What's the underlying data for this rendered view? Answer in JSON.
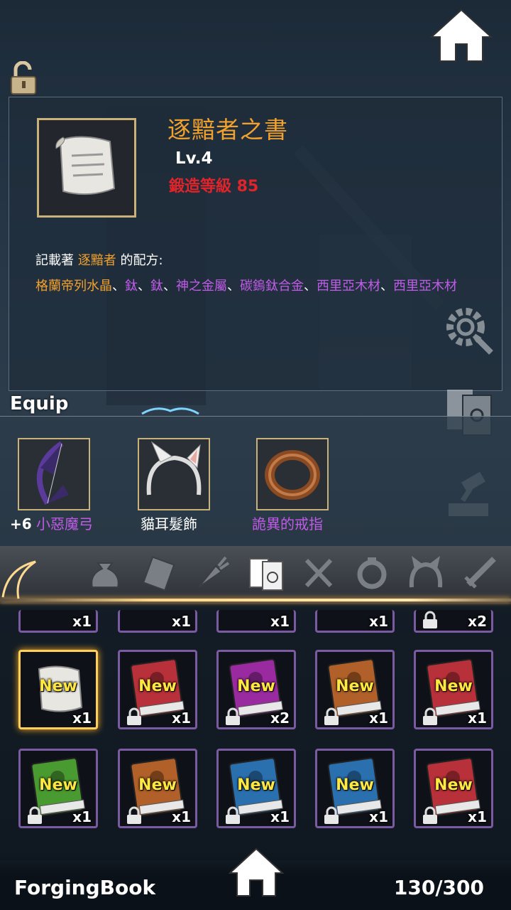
{
  "item": {
    "name": "逐黯者之書",
    "level": "Lv.4",
    "forge_level": "鍛造等級 85",
    "desc_prefix": "記載著",
    "desc_target": "逐黯者",
    "desc_suffix": "的配方:",
    "recipe": [
      {
        "text": "格蘭帝列水晶",
        "color": "orange"
      },
      {
        "text": "、",
        "color": "white"
      },
      {
        "text": "鈦",
        "color": "purple"
      },
      {
        "text": "、",
        "color": "white"
      },
      {
        "text": "鈦",
        "color": "purple"
      },
      {
        "text": "、",
        "color": "white"
      },
      {
        "text": "神之金屬",
        "color": "purple"
      },
      {
        "text": "、",
        "color": "white"
      },
      {
        "text": "碳鎢鈦合金",
        "color": "purple"
      },
      {
        "text": "、",
        "color": "white"
      },
      {
        "text": "西里亞木材",
        "color": "purple"
      },
      {
        "text": "、",
        "color": "white"
      },
      {
        "text": "西里亞木材",
        "color": "purple"
      }
    ]
  },
  "equip": {
    "label": "Equip",
    "slots": [
      {
        "prefix": "+6",
        "name": "小惡魔弓",
        "color": "#c05be8",
        "icon": "bow-icon"
      },
      {
        "prefix": "",
        "name": "貓耳髮飾",
        "color": "#ffffff",
        "icon": "cat-ear-headband-icon"
      },
      {
        "prefix": "",
        "name": "詭異的戒指",
        "color": "#c05be8",
        "icon": "ring-icon"
      }
    ]
  },
  "categories": [
    "bag-icon",
    "scroll-icon",
    "carrot-icon",
    "book-icon",
    "fork-knife-icon",
    "ring-icon",
    "headband-icon",
    "sword-icon"
  ],
  "grid": {
    "row0": [
      {
        "qty": "x1",
        "locked": false
      },
      {
        "qty": "x1",
        "locked": false
      },
      {
        "qty": "x1",
        "locked": false
      },
      {
        "qty": "x1",
        "locked": false
      },
      {
        "qty": "x2",
        "locked": true
      }
    ],
    "row1": [
      {
        "qty": "x1",
        "new": "New",
        "locked": false,
        "kind": "scroll",
        "selected": true
      },
      {
        "qty": "x1",
        "new": "New",
        "locked": true,
        "kind": "book",
        "color": "#b8303a"
      },
      {
        "qty": "x2",
        "new": "New",
        "locked": true,
        "kind": "book",
        "color": "#9a2aa0"
      },
      {
        "qty": "x1",
        "new": "New",
        "locked": true,
        "kind": "book",
        "color": "#b06028"
      },
      {
        "qty": "x1",
        "new": "New",
        "locked": true,
        "kind": "book",
        "color": "#b8303a"
      }
    ],
    "row2": [
      {
        "qty": "x1",
        "new": "New",
        "locked": true,
        "kind": "book",
        "color": "#4a9a32"
      },
      {
        "qty": "x1",
        "new": "New",
        "locked": true,
        "kind": "book",
        "color": "#b06028"
      },
      {
        "qty": "x1",
        "new": "New",
        "locked": true,
        "kind": "book",
        "color": "#2a6fae"
      },
      {
        "qty": "x1",
        "new": "New",
        "locked": true,
        "kind": "book",
        "color": "#2a6fae"
      },
      {
        "qty": "x1",
        "new": "New",
        "locked": true,
        "kind": "book",
        "color": "#b8303a"
      }
    ]
  },
  "footer": {
    "title": "ForgingBook",
    "count": "130/300"
  },
  "colors": {
    "accent": "#f2a12c",
    "forge": "#e0242a",
    "rare": "#c05be8",
    "frame": "#c9b27a"
  }
}
